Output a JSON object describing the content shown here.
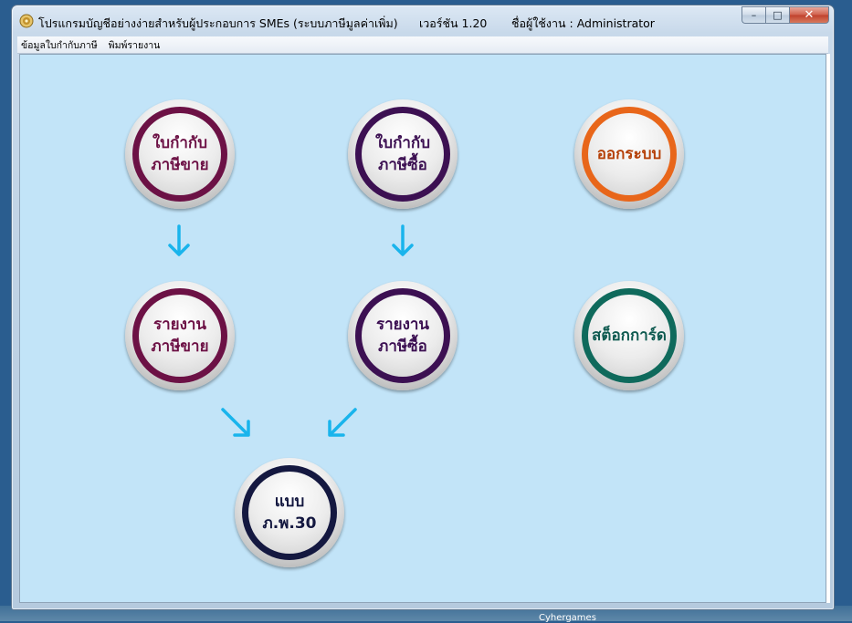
{
  "window": {
    "title": "โปรแกรมบัญชีอย่างง่ายสำหรับผู้ประกอบการ SMEs  (ระบบภาษีมูลค่าเพิ่ม)",
    "version": "เวอร์ชัน 1.20",
    "user": "ชื่อผู้ใช้งาน : Administrator",
    "app_icon": "seal-icon",
    "caption": {
      "minimize": "–",
      "maximize": "□",
      "close": "✕"
    }
  },
  "menu": {
    "items": [
      {
        "label": "ข้อมูลใบกำกับภาษี"
      },
      {
        "label": "พิมพ์รายงาน"
      }
    ]
  },
  "buttons": {
    "sales_invoice": {
      "line1": "ใบกำกับ",
      "line2": "ภาษีขาย",
      "color": "#6c1145"
    },
    "purchase_invoice": {
      "line1": "ใบกำกับ",
      "line2": "ภาษีซื้อ",
      "color": "#3c1052"
    },
    "logout": {
      "line1": "ออกระบบ",
      "color": "#e8661a"
    },
    "sales_report": {
      "line1": "รายงาน",
      "line2": "ภาษีขาย",
      "color": "#6c1145"
    },
    "purchase_report": {
      "line1": "รายงาน",
      "line2": "ภาษีซื้อ",
      "color": "#3c1052"
    },
    "stock_card": {
      "line1": "สต็อกการ์ด",
      "color": "#0f6a5c"
    },
    "pp30": {
      "line1": "แบบ",
      "line2": "ภ.พ.30",
      "color": "#141840"
    }
  },
  "flow": {
    "arrow_color": "#19b4ec",
    "arrow_icon": "arrow-icon"
  },
  "desktop": {
    "label": "Cyhergames"
  }
}
